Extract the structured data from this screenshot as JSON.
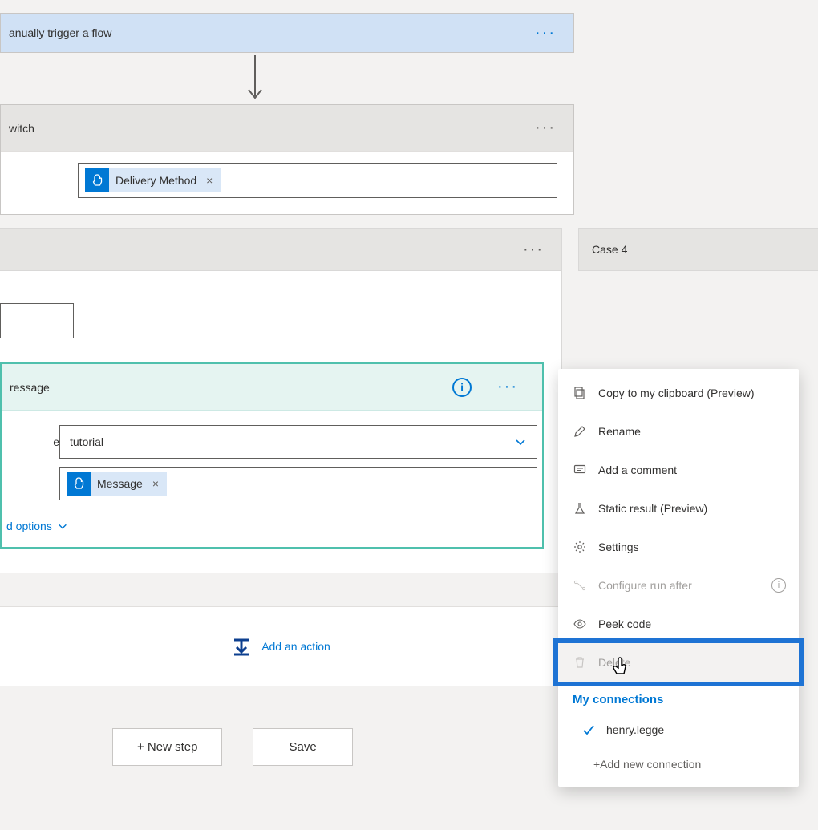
{
  "trigger": {
    "title": "anually trigger a flow"
  },
  "switchCard": {
    "title": "witch",
    "token": "Delivery Method"
  },
  "caseStrip": {
    "case4": "Case 4"
  },
  "action": {
    "title": "ressage",
    "field1_label": "e",
    "field1_value": "tutorial",
    "field2_token": "Message",
    "advanced": "d options"
  },
  "addAction": "Add an action",
  "buttons": {
    "newStep": "+ New step",
    "save": "Save"
  },
  "menu": {
    "copy": "Copy to my clipboard (Preview)",
    "rename": "Rename",
    "comment": "Add a comment",
    "staticResult": "Static result (Preview)",
    "settings": "Settings",
    "configureRunAfter": "Configure run after",
    "peekCode": "Peek code",
    "delete": "Delete",
    "myConnections": "My connections",
    "connection": "henry.legge",
    "addConnection": "+Add new connection"
  }
}
